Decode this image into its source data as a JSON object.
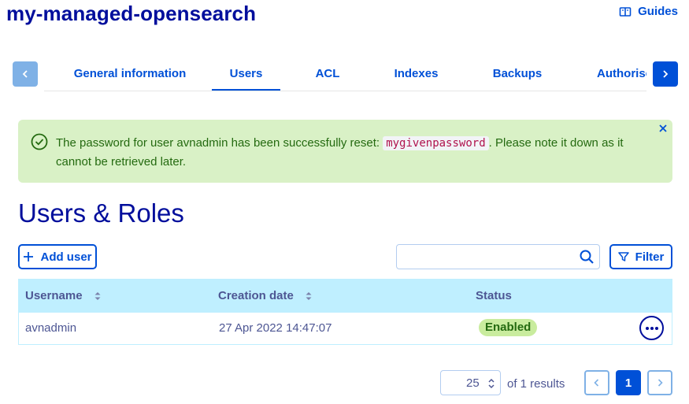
{
  "header": {
    "title": "my-managed-opensearch",
    "guides_label": "Guides",
    "guides_icon": "book-icon"
  },
  "tabs": {
    "items": [
      {
        "label": "General information",
        "active": false
      },
      {
        "label": "Users",
        "active": true
      },
      {
        "label": "ACL",
        "active": false
      },
      {
        "label": "Indexes",
        "active": false
      },
      {
        "label": "Backups",
        "active": false
      },
      {
        "label": "Authorise",
        "active": false
      }
    ],
    "prev_icon": "chevron-left-icon",
    "next_icon": "chevron-right-icon"
  },
  "alert": {
    "type": "success",
    "text_before": "The password for user avnadmin has been successfully reset: ",
    "password": "mygivenpassword",
    "text_after": ". Please note it down as it cannot be retrieved later.",
    "icon": "check-circle-icon",
    "close_icon": "close-icon"
  },
  "section": {
    "title": "Users & Roles"
  },
  "toolbar": {
    "add_user_label": "Add user",
    "filter_label": "Filter",
    "search_value": "",
    "search_placeholder": ""
  },
  "table": {
    "columns": [
      "Username",
      "Creation date",
      "Status"
    ],
    "sortable": [
      true,
      true,
      false
    ],
    "rows": [
      {
        "username": "avnadmin",
        "creation_date": "27 Apr 2022 14:47:07",
        "status": "Enabled"
      }
    ]
  },
  "pagination": {
    "page_size": "25",
    "results_text": "of 1 results",
    "current_page": "1"
  },
  "colors": {
    "primary": "#0050d7",
    "title": "#000e9c",
    "success_bg": "#d9f1c6",
    "success_text": "#246a10",
    "table_header_bg": "#bfefff",
    "badge_bg": "#c9ec9e"
  }
}
